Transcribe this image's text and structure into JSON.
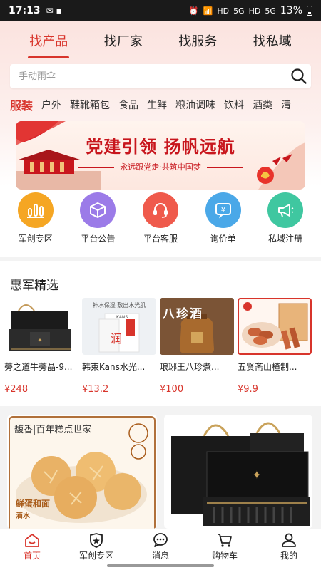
{
  "status_bar": {
    "time": "17:13",
    "battery": "13%",
    "network": [
      "HD",
      "5G",
      "HD",
      "5G"
    ]
  },
  "main_tabs": [
    {
      "label": "找产品",
      "active": true
    },
    {
      "label": "找厂家",
      "active": false
    },
    {
      "label": "找服务",
      "active": false
    },
    {
      "label": "找私域",
      "active": false
    }
  ],
  "search": {
    "placeholder": "手动雨伞",
    "icon": "search-icon"
  },
  "categories": [
    {
      "label": "服装",
      "active": true
    },
    {
      "label": "户外"
    },
    {
      "label": "鞋靴箱包"
    },
    {
      "label": "食品"
    },
    {
      "label": "生鲜"
    },
    {
      "label": "粮油调味"
    },
    {
      "label": "饮料"
    },
    {
      "label": "酒类"
    },
    {
      "label": "清"
    }
  ],
  "banner": {
    "title": "党建引领  扬帆远航",
    "subtitle": "永远跟党走·共筑中国梦"
  },
  "quick_links": [
    {
      "label": "军创专区",
      "icon": "bar-chart-icon",
      "color": "#f5a623"
    },
    {
      "label": "平台公告",
      "icon": "cube-icon",
      "color": "#9b7be8"
    },
    {
      "label": "平台客服",
      "icon": "headset-icon",
      "color": "#ef5a4c"
    },
    {
      "label": "询价单",
      "icon": "yen-chat-icon",
      "color": "#4aa8e8"
    },
    {
      "label": "私域注册",
      "icon": "megaphone-icon",
      "color": "#3fc7a0"
    }
  ],
  "featured": {
    "title": "惠军精选",
    "products": [
      {
        "name": "蒡之道牛蒡晶-9...",
        "price": "¥248"
      },
      {
        "name": "韩束Kans水光...",
        "price": "¥13.2"
      },
      {
        "name": "琅琊王八珍煮...",
        "price": "¥100"
      },
      {
        "name": "五贤斋山楂制...",
        "price": "¥9.9"
      }
    ],
    "product_texts": {
      "kans_top": "补水保湿 敷出水光肌",
      "kans_brand": "KANS",
      "kans_char": "润",
      "wine_text": "八珍酒"
    }
  },
  "feature_cards": {
    "left_brand": "馥香|百年糕点世家",
    "left_tag": "鲜蛋和面",
    "left_tag2": "滴水"
  },
  "bottom_nav": [
    {
      "label": "首页",
      "icon": "home-icon",
      "active": true
    },
    {
      "label": "军创专区",
      "icon": "shield-star-icon",
      "active": false
    },
    {
      "label": "消息",
      "icon": "message-icon",
      "active": false
    },
    {
      "label": "购物车",
      "icon": "cart-icon",
      "active": false
    },
    {
      "label": "我的",
      "icon": "user-icon",
      "active": false
    }
  ],
  "colors": {
    "accent": "#d8342b"
  }
}
